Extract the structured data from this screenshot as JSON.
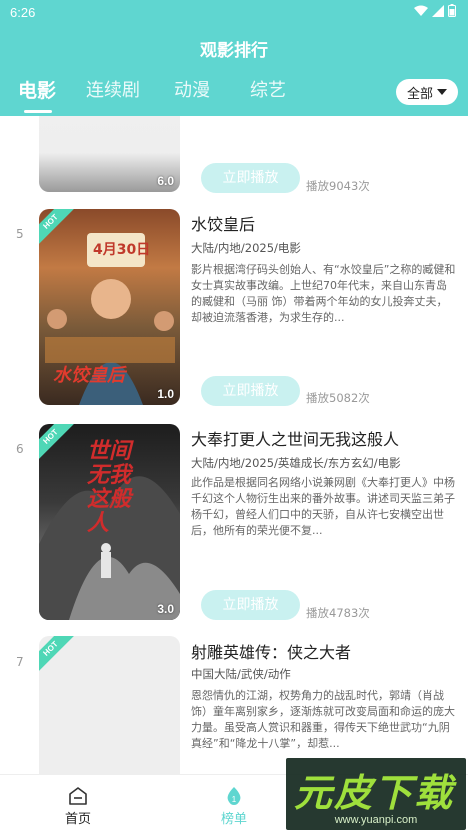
{
  "status_bar": {
    "time": "6:26"
  },
  "app": {
    "title": "观影排行"
  },
  "tabs": [
    {
      "label": "电影",
      "active": true
    },
    {
      "label": "连续剧",
      "active": false
    },
    {
      "label": "动漫",
      "active": false
    },
    {
      "label": "综艺",
      "active": false
    }
  ],
  "filter": {
    "label": "全部"
  },
  "list": {
    "play_label": "立即播放",
    "hot_badge": "HOT",
    "items": [
      {
        "rank": "",
        "score": "6.0",
        "title": "",
        "meta": "",
        "desc": "",
        "plays": "播放9043次"
      },
      {
        "rank": "5",
        "score": "1.0",
        "title": "水饺皇后",
        "meta": "大陆/内地/2025/电影",
        "desc": "影片根据湾仔码头创始人、有“水饺皇后”之称的臧健和女士真实故事改编。上世纪70年代末，来自山东青岛的臧健和（马丽 饰）带着两个年幼的女儿投奔丈夫，却被迫流落香港，为求生存的...",
        "plays": "播放5082次",
        "poster_text": "4月30日",
        "poster_subtext": "水饺皇后"
      },
      {
        "rank": "6",
        "score": "3.0",
        "title": "大奉打更人之世间无我这般人",
        "meta": "大陆/内地/2025/英雄成长/东方玄幻/电影",
        "desc": "此作品是根据同名网络小说兼网剧《大奉打更人》中杨千幻这个人物衍生出来的番外故事。讲述司天监三弟子杨千幻，曾经人们口中的天骄，自从许七安横空出世后，他所有的荣光便不复...",
        "plays": "播放4783次",
        "poster_text": "世间无我这般人"
      },
      {
        "rank": "7",
        "score": "",
        "title": "射雕英雄传：侠之大者",
        "meta": "中国大陆/武侠/动作",
        "desc": "恩怨情仇的江湖，权势角力的战乱时代，郭靖（肖战 饰）童年离别家乡，逐渐炼就可改变局面和命运的庞大力量。虽受高人赏识和器重，得传天下绝世武功“九阴真经”和“降龙十八掌”，却惹...",
        "plays": ""
      }
    ]
  },
  "bottom_nav": [
    {
      "label": "首页",
      "icon": "home-icon",
      "active": false
    },
    {
      "label": "榜单",
      "icon": "ranking-icon",
      "active": true
    }
  ],
  "watermark": {
    "logo": "元皮下载",
    "url": "www.yuanpi.com"
  },
  "colors": {
    "accent": "#5fd6d0",
    "play_button": "#c9f1f0",
    "hot_badge": "#4fd7b6",
    "nav_active": "#5fd6d0"
  }
}
